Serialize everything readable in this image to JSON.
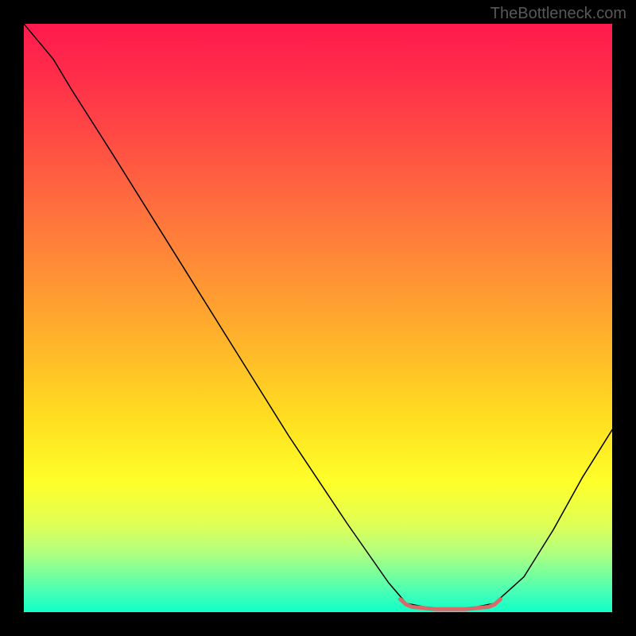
{
  "watermark": "TheBottleneck.com",
  "chart_data": {
    "type": "line",
    "title": "",
    "xlabel": "",
    "ylabel": "",
    "xlim": [
      0,
      100
    ],
    "ylim": [
      0,
      100
    ],
    "background_gradient": {
      "direction": "vertical",
      "stops": [
        {
          "pos": 0,
          "color": "#ff1a4d"
        },
        {
          "pos": 50,
          "color": "#ffa130"
        },
        {
          "pos": 78,
          "color": "#feff2a"
        },
        {
          "pos": 100,
          "color": "#10ffc8"
        }
      ]
    },
    "series": [
      {
        "name": "curve",
        "color": "#000000",
        "width": 1.5,
        "points": [
          {
            "x": 0,
            "y": 100
          },
          {
            "x": 5,
            "y": 94
          },
          {
            "x": 8,
            "y": 89
          },
          {
            "x": 15,
            "y": 78
          },
          {
            "x": 25,
            "y": 62
          },
          {
            "x": 35,
            "y": 46
          },
          {
            "x": 45,
            "y": 30
          },
          {
            "x": 55,
            "y": 15
          },
          {
            "x": 62,
            "y": 5
          },
          {
            "x": 65,
            "y": 1.5
          },
          {
            "x": 70,
            "y": 0.5
          },
          {
            "x": 75,
            "y": 0.5
          },
          {
            "x": 80,
            "y": 1.5
          },
          {
            "x": 85,
            "y": 6
          },
          {
            "x": 90,
            "y": 14
          },
          {
            "x": 95,
            "y": 23
          },
          {
            "x": 100,
            "y": 31
          }
        ]
      },
      {
        "name": "highlight-segment",
        "color": "#d96a6a",
        "width": 5,
        "points": [
          {
            "x": 64,
            "y": 2.2
          },
          {
            "x": 65,
            "y": 1.3
          },
          {
            "x": 66,
            "y": 0.9
          },
          {
            "x": 70,
            "y": 0.5
          },
          {
            "x": 75,
            "y": 0.5
          },
          {
            "x": 79,
            "y": 0.9
          },
          {
            "x": 80,
            "y": 1.3
          },
          {
            "x": 81,
            "y": 2.2
          }
        ]
      }
    ]
  }
}
